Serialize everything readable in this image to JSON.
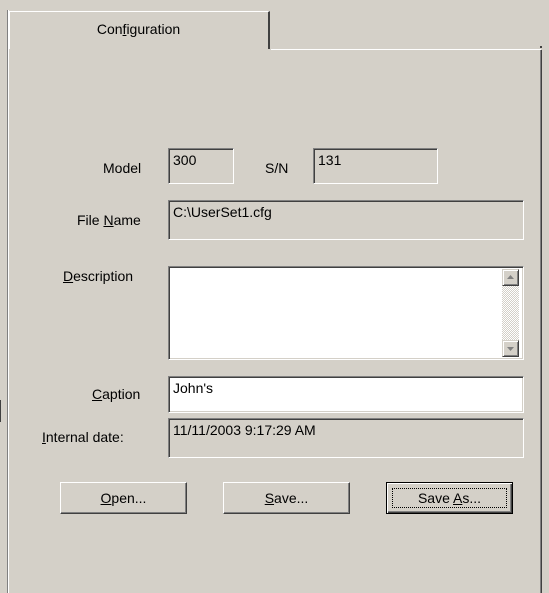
{
  "tabs": [
    {
      "label_pre": "Con",
      "label_accel": "f",
      "label_post": "iguration"
    }
  ],
  "fields": {
    "model": {
      "label": "Model",
      "value": "300"
    },
    "serial": {
      "label": "S/N",
      "value": "131"
    },
    "file_name": {
      "label_pre": "File ",
      "label_accel": "N",
      "label_post": "ame",
      "value": "C:\\UserSet1.cfg"
    },
    "description": {
      "label_pre": "",
      "label_accel": "D",
      "label_post": "escription",
      "value": ""
    },
    "caption": {
      "label_pre": "",
      "label_accel": "C",
      "label_post": "aption",
      "value": "John's"
    },
    "internal_date": {
      "label_pre": "",
      "label_accel": "I",
      "label_post": "nternal date:",
      "value": "11/11/2003 9:17:29 AM"
    }
  },
  "buttons": {
    "open": {
      "label_pre": "",
      "label_accel": "O",
      "label_post": "pen..."
    },
    "save": {
      "label_pre": "",
      "label_accel": "S",
      "label_post": "ave..."
    },
    "save_as": {
      "label_pre": "Save ",
      "label_accel": "A",
      "label_post": "s..."
    }
  },
  "icons": {
    "scroll_up": "scroll-up-arrow-icon",
    "scroll_down": "scroll-down-arrow-icon"
  },
  "colors": {
    "face": "#d4d0c8",
    "window": "#ffffff",
    "shadow": "#808080",
    "dark_shadow": "#404040"
  }
}
